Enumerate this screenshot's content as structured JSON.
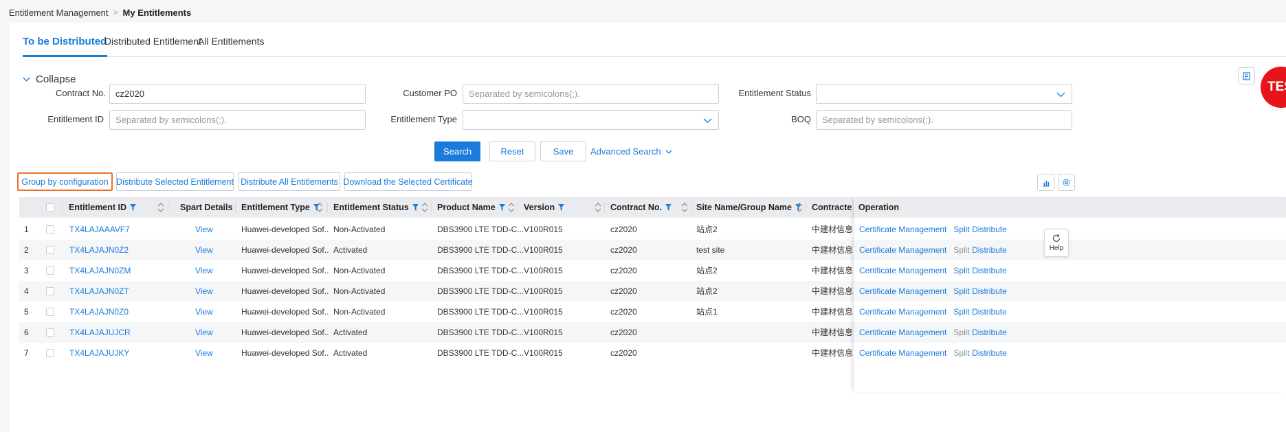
{
  "breadcrumb": {
    "parent": "Entitlement Management",
    "current": "My Entitlements"
  },
  "tabs": [
    {
      "label": "To be Distributed",
      "active": true
    },
    {
      "label": "Distributed Entitlement",
      "active": false
    },
    {
      "label": "All Entitlements",
      "active": false
    }
  ],
  "filter": {
    "collapse_label": "Collapse",
    "contract_no": {
      "label": "Contract No.",
      "value": "cz2020"
    },
    "customer_po": {
      "label": "Customer PO",
      "placeholder": "Separated by semicolons(;)."
    },
    "entitlement_status": {
      "label": "Entitlement Status",
      "value": ""
    },
    "entitlement_id": {
      "label": "Entitlement ID",
      "placeholder": "Separated by semicolons(;)."
    },
    "entitlement_type": {
      "label": "Entitlement Type",
      "value": ""
    },
    "boq": {
      "label": "BOQ",
      "placeholder": "Separated by semicolons(;)."
    },
    "search_label": "Search",
    "reset_label": "Reset",
    "save_label": "Save",
    "advanced_label": "Advanced Search"
  },
  "avatar_text": "TES",
  "toolbar": {
    "group_label": "Group by configuration",
    "distribute_selected_label": "Distribute Selected Entitlement",
    "distribute_all_label": "Distribute All Entitlements",
    "download_label": "Download the Selected Certificate"
  },
  "table": {
    "headers": {
      "entitlement_id": "Entitlement ID",
      "spart": "Spart Details",
      "type": "Entitlement Type",
      "status": "Entitlement Status",
      "product": "Product Name",
      "version": "Version",
      "contract": "Contract No.",
      "site": "Site Name/Group Name",
      "contractor": "Contracte",
      "operation": "Operation"
    },
    "operation_labels": {
      "cert": "Certificate Management",
      "split": "Split",
      "distribute": "Distribute"
    },
    "rows": [
      {
        "no": "1",
        "id": "TX4LAJAAAVF7",
        "spart": "View",
        "type": "Huawei-developed Sof...",
        "status": "Non-Activated",
        "product": "DBS3900 LTE TDD-C...",
        "version": "V100R015",
        "contract": "cz2020",
        "site": "站点2",
        "contractor": "中建材信息",
        "split_enabled": true
      },
      {
        "no": "2",
        "id": "TX4LAJAJN0Z2",
        "spart": "View",
        "type": "Huawei-developed Sof...",
        "status": "Activated",
        "product": "DBS3900 LTE TDD-C...",
        "version": "V100R015",
        "contract": "cz2020",
        "site": "test site",
        "contractor": "中建材信息",
        "split_enabled": false
      },
      {
        "no": "3",
        "id": "TX4LAJAJN0ZM",
        "spart": "View",
        "type": "Huawei-developed Sof...",
        "status": "Non-Activated",
        "product": "DBS3900 LTE TDD-C...",
        "version": "V100R015",
        "contract": "cz2020",
        "site": "站点2",
        "contractor": "中建材信息",
        "split_enabled": true
      },
      {
        "no": "4",
        "id": "TX4LAJAJN0ZT",
        "spart": "View",
        "type": "Huawei-developed Sof...",
        "status": "Non-Activated",
        "product": "DBS3900 LTE TDD-C...",
        "version": "V100R015",
        "contract": "cz2020",
        "site": "站点2",
        "contractor": "中建材信息",
        "split_enabled": true
      },
      {
        "no": "5",
        "id": "TX4LAJAJN0Z0",
        "spart": "View",
        "type": "Huawei-developed Sof...",
        "status": "Non-Activated",
        "product": "DBS3900 LTE TDD-C...",
        "version": "V100R015",
        "contract": "cz2020",
        "site": "站点1",
        "contractor": "中建材信息",
        "split_enabled": true
      },
      {
        "no": "6",
        "id": "TX4LAJAJUJCR",
        "spart": "View",
        "type": "Huawei-developed Sof...",
        "status": "Activated",
        "product": "DBS3900 LTE TDD-C...",
        "version": "V100R015",
        "contract": "cz2020",
        "site": "",
        "contractor": "中建材信息",
        "split_enabled": false
      },
      {
        "no": "7",
        "id": "TX4LAJAJUJKY",
        "spart": "View",
        "type": "Huawei-developed Sof...",
        "status": "Activated",
        "product": "DBS3900 LTE TDD-C...",
        "version": "V100R015",
        "contract": "cz2020",
        "site": "",
        "contractor": "中建材信息",
        "split_enabled": false
      }
    ]
  },
  "help_label": "Help",
  "colors": {
    "accent": "#1a7bdc",
    "focus_border": "#f06e2c",
    "avatar": "#e8141b"
  }
}
